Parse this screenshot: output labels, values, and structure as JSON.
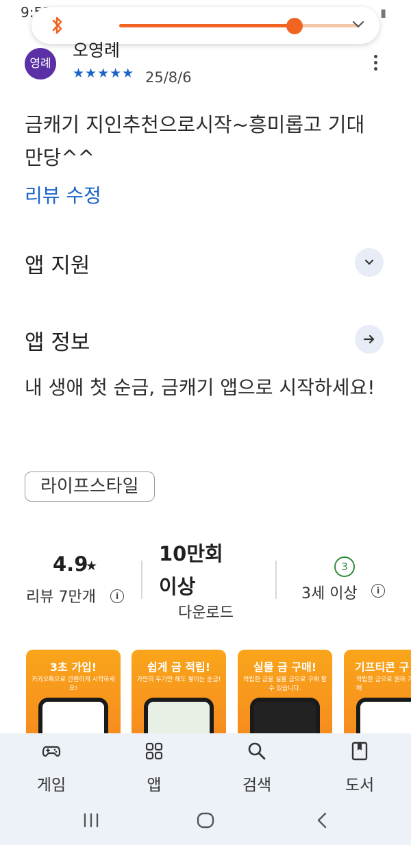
{
  "status_bar": {
    "time": "9:55",
    "icons": "◉ ✱ ▦ ᯤ ▮"
  },
  "media_overlay": {
    "progress": 0.73,
    "accent_color": "#f26422",
    "bluetooth_icon": "bluetooth-icon",
    "collapse_icon": "chevron-down-icon"
  },
  "review": {
    "avatar_text": "영례",
    "reviewer_name": "오영례",
    "stars": "★★★★★",
    "rating": 5,
    "date": "25/8/6",
    "text": "금캐기 지인추천으로시작~흥미롭고 기대만당^^",
    "edit_label": "리뷰 수정"
  },
  "app_support": {
    "title": "앱 지원"
  },
  "app_info": {
    "title": "앱 정보",
    "description": "내 생애 첫 순금, 금캐기 앱으로 시작하세요!",
    "category": "라이프스타일"
  },
  "stats": {
    "rating_value": "4.9",
    "rating_star": "★",
    "reviews_label": "리뷰 7만개",
    "downloads_value": "10만회 이상",
    "downloads_label": "다운로드",
    "age_badge": "3",
    "age_label": "3세 이상"
  },
  "screenshots": [
    {
      "title": "3초 가입!",
      "subtitle": "카카오톡으로 간편하게 시작하세요!"
    },
    {
      "title": "쉽게 금 적립!",
      "subtitle": "가만히 두기만 해도 쌓이는 순금!"
    },
    {
      "title": "실물 금 구매!",
      "subtitle": "적립한 금을 실물 금으로 구매 할 수 있습니다."
    },
    {
      "title": "기프티콘 구",
      "subtitle": "적립한 금으로 원하 기프티콘을 구매"
    }
  ],
  "bottom_nav": {
    "items": [
      {
        "label": "게임",
        "icon": "gamepad-icon"
      },
      {
        "label": "앱",
        "icon": "apps-grid-icon"
      },
      {
        "label": "검색",
        "icon": "search-icon"
      },
      {
        "label": "도서",
        "icon": "book-icon"
      }
    ]
  }
}
